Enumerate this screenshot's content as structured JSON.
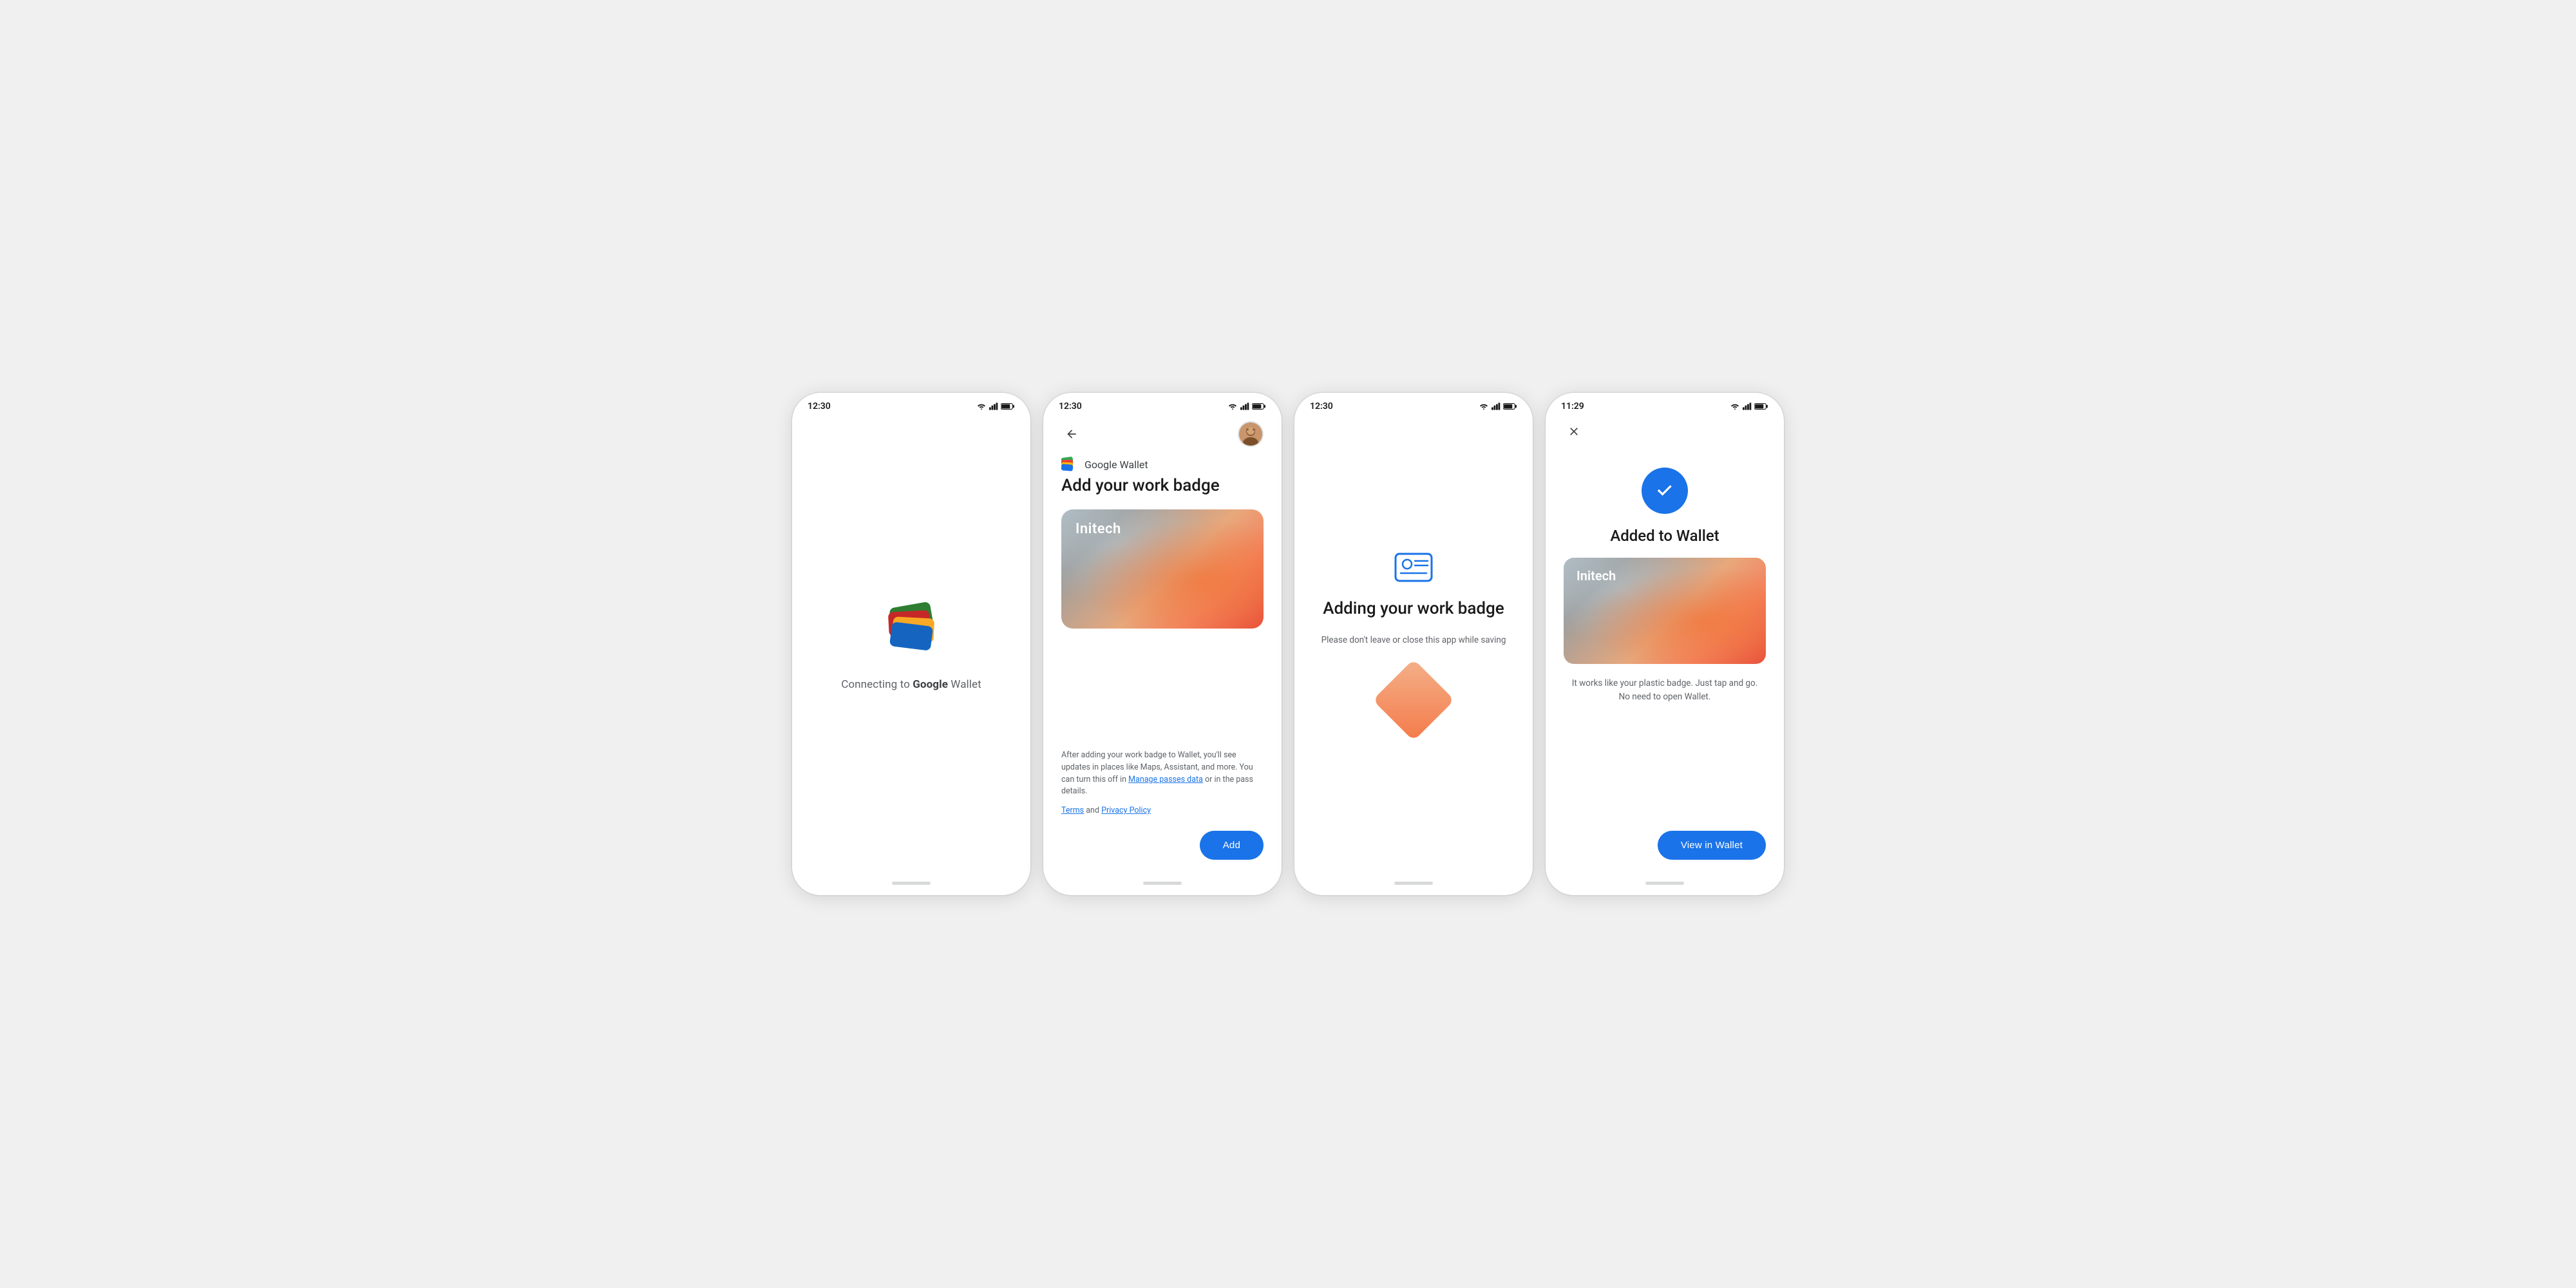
{
  "screens": [
    {
      "id": "screen1",
      "statusBar": {
        "time": "12:30"
      },
      "content": {
        "connectingText": "Connecting to ",
        "googleText": "Google",
        "walletText": " Wallet"
      }
    },
    {
      "id": "screen2",
      "statusBar": {
        "time": "12:30"
      },
      "logoText": "Google Wallet",
      "title": "Add your work badge",
      "badgeCompany": "Initech",
      "infoText": "After adding your work badge to Wallet, you'll see updates in places like Maps, Assistant, and more. You can turn this off in ",
      "manageLink": "Manage passes data",
      "infoText2": " or in the pass details.",
      "termsText": "Terms",
      "andText": " and ",
      "privacyText": "Privacy Policy",
      "addButtonLabel": "Add"
    },
    {
      "id": "screen3",
      "statusBar": {
        "time": "12:30"
      },
      "title": "Adding your work badge",
      "subtitle": "Please don't leave or close this app while saving"
    },
    {
      "id": "screen4",
      "statusBar": {
        "time": "11:29"
      },
      "title": "Added to Wallet",
      "badgeCompany": "Initech",
      "description": "It works like your plastic badge. Just tap and go.\nNo need to open Wallet.",
      "viewButtonLabel": "View in Wallet"
    }
  ]
}
